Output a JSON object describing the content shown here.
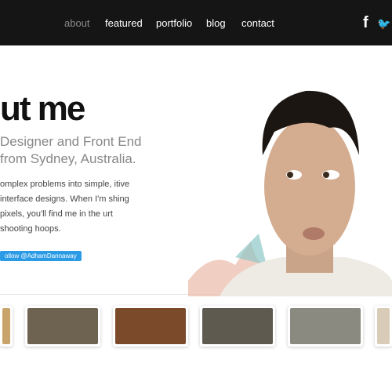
{
  "nav": {
    "items": [
      {
        "label": "about",
        "active": true
      },
      {
        "label": "featured"
      },
      {
        "label": "portfolio"
      },
      {
        "label": "blog"
      },
      {
        "label": "contact"
      }
    ],
    "social": [
      {
        "icon": "facebook-icon",
        "glyph": "f"
      },
      {
        "icon": "twitter-icon",
        "glyph": "🐦"
      }
    ]
  },
  "hero": {
    "title": "ut me",
    "subtitle": "Designer and Front End from Sydney, Australia.",
    "body": "omplex problems into simple, itive interface designs. When I'm shing pixels, you'll find me in the urt shooting hoops.",
    "follow_label": "ollow @AdhamDannaway",
    "accent": "#2b9be6"
  },
  "thumbs": [
    {
      "color": "#c9a46a"
    },
    {
      "color": "#6e6250"
    },
    {
      "color": "#7a4a2a"
    },
    {
      "color": "#5f5a50"
    },
    {
      "color": "#8a8a80"
    },
    {
      "color": "#d8cbb8"
    }
  ]
}
